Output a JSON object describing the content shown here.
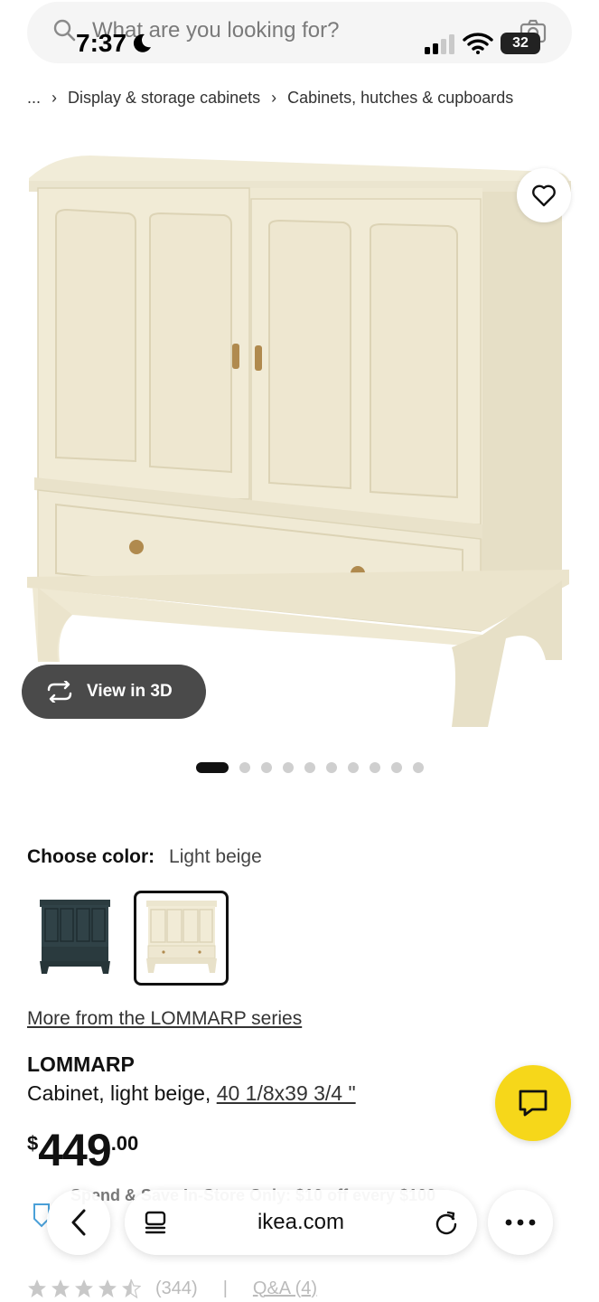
{
  "status_bar": {
    "time": "7:37",
    "battery": "32"
  },
  "search": {
    "placeholder": "What are you looking for?"
  },
  "breadcrumb": {
    "items": [
      "...",
      "Display & storage cabinets",
      "Cabinets, hutches & cupboards"
    ]
  },
  "gallery": {
    "view_3d_label": "View in 3D",
    "image_count": 10,
    "active_index": 0
  },
  "color_choice": {
    "label": "Choose color:",
    "selected": "Light beige",
    "swatch_colors": [
      "#2c3c40",
      "#efe9d2"
    ]
  },
  "product": {
    "series_link": "More from the LOMMARP series",
    "name": "LOMMARP",
    "description": "Cabinet, light beige, ",
    "dimensions": "40 1/8x39 3/4 \"",
    "price": {
      "currency": "$",
      "integer": "449",
      "decimal": ".00"
    }
  },
  "promo": {
    "line1": "Spend & Save In-Store Only: $10 off every $100"
  },
  "rating": {
    "stars": 4.5,
    "count": "(344)",
    "qa": "Q&A (4)"
  },
  "browser": {
    "url": "ikea.com"
  },
  "colors": {
    "accent_yellow": "#f6d71a",
    "cabinet": "#efe9d2",
    "view3d_bg": "#4a4a4a"
  }
}
